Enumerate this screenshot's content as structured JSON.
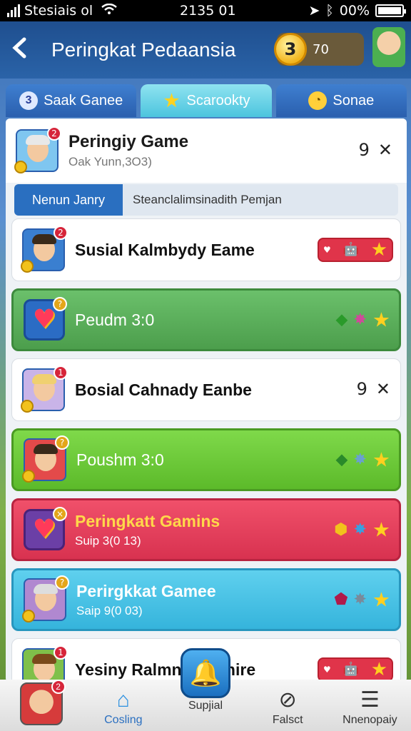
{
  "status_bar": {
    "carrier": "Stesiais ol",
    "time": "2135 01",
    "battery": "00%"
  },
  "header": {
    "title": "Peringkat Pedaansia",
    "coin_count": "3",
    "coin_amount": "70"
  },
  "tabs": [
    {
      "label": "Saak Ganee",
      "icon": "3"
    },
    {
      "label": "Scarookty",
      "icon": "star-icon"
    },
    {
      "label": "Sonae",
      "icon": "clock-icon"
    }
  ],
  "profile": {
    "name": "Peringiy Game",
    "subtitle": "Oak Yunn,3O3)",
    "rank": "9",
    "close": "✕"
  },
  "filter": {
    "button": "Nenun Janry",
    "text": "Steanclalimsinadith Pemjan"
  },
  "rows": [
    {
      "title": "Susial Kalmbydy Eame",
      "style": "white"
    },
    {
      "title": "Peudm 3:0",
      "style": "green"
    },
    {
      "title": "Bosial Cahnady Eanbe",
      "style": "white",
      "rank": "9",
      "close": "✕"
    },
    {
      "title": "Poushm 3:0",
      "style": "lime"
    },
    {
      "title": "Peringkatt Gamins",
      "subtitle": "Suip 3(0 13)",
      "style": "red"
    },
    {
      "title": "Perirgkkat Gamee",
      "subtitle": "Saip 9(0 03)",
      "style": "cyan"
    },
    {
      "title": "Yesiny Ralmndy Panire",
      "style": "white"
    }
  ],
  "nav": [
    {
      "label": ""
    },
    {
      "label": "Cosling"
    },
    {
      "label": "Supjial"
    },
    {
      "label": "Falsct"
    },
    {
      "label": "Nnenopaiy"
    }
  ],
  "colors": {
    "header": "#2a63a8",
    "accent_blue": "#2a6fc0",
    "gold": "#f2b51c"
  }
}
